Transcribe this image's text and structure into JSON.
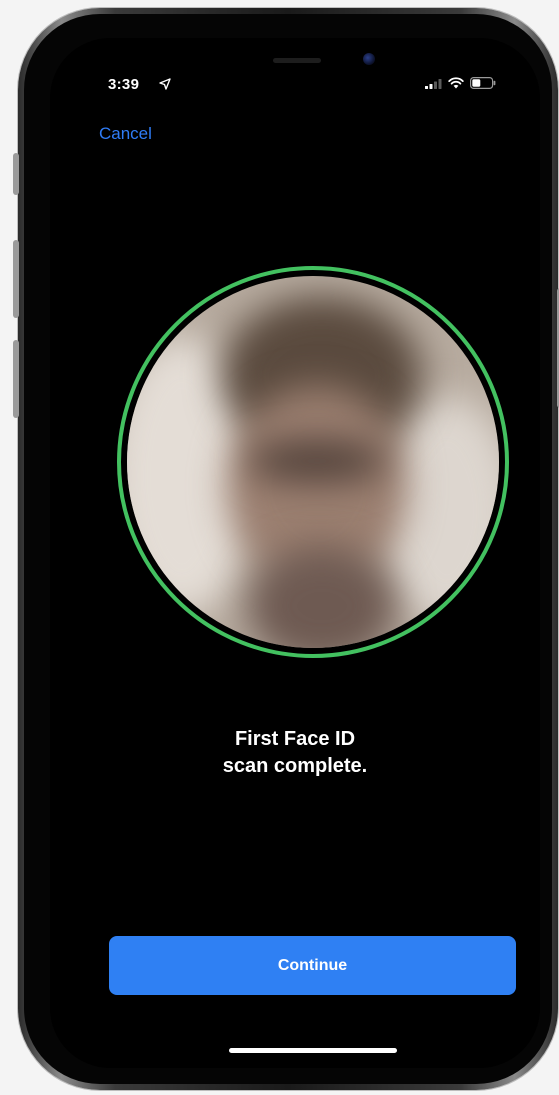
{
  "status_bar": {
    "time": "3:39",
    "location_icon": "location-arrow-icon",
    "signal_icon": "cellular-signal-icon",
    "wifi_icon": "wifi-icon",
    "battery_icon": "battery-icon"
  },
  "nav": {
    "cancel_label": "Cancel"
  },
  "scan": {
    "ring_color": "#43c160",
    "message_line1": "First Face ID",
    "message_line2": "scan complete."
  },
  "actions": {
    "continue_label": "Continue"
  },
  "colors": {
    "accent": "#2f80f3",
    "link": "#2f7cf6",
    "background": "#000000",
    "success_ring": "#43c160"
  }
}
